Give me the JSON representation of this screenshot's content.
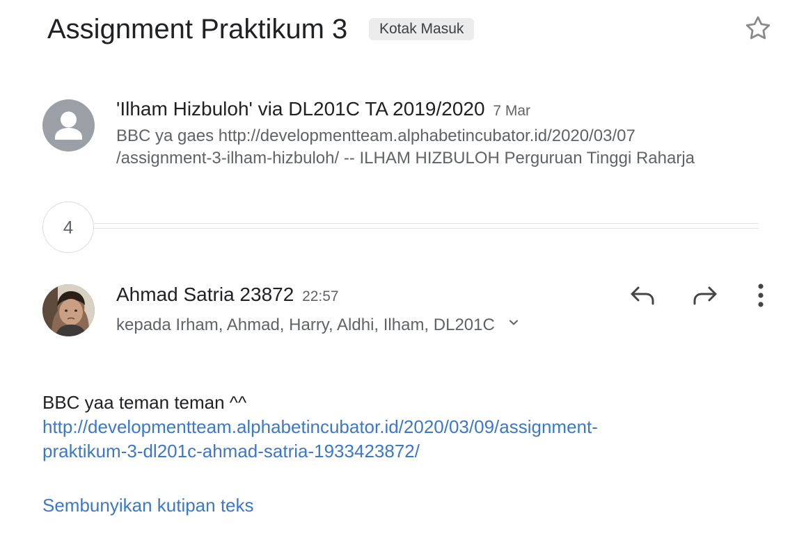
{
  "thread": {
    "subject": "Assignment Praktikum 3",
    "label": "Kotak Masuk",
    "star_icon": "star-outline-icon"
  },
  "messages": [
    {
      "sender": "'Ilham Hizbuloh' via DL201C TA 2019/2020",
      "date": "7 Mar",
      "snippet_line1": "BBC ya gaes http://developmentteam.alphabetincubator.id/2020/03/07",
      "snippet_line2": "/assignment-3-ilham-hizbuloh/ -- ILHAM HIZBULOH Perguruan Tinggi Raharja",
      "avatar_icon": "person-placeholder-icon"
    }
  ],
  "collapsed": {
    "count": "4"
  },
  "open_message": {
    "sender": "Ahmad Satria 23872",
    "time": "22:57",
    "recipients": "kepada Irham, Ahmad, Harry, Aldhi, Ilham, DL201C",
    "body_text": "BBC yaa teman teman ^^",
    "link_line1": "http://developmentteam.alphabetincubator.id/2020/03/09/assignment-",
    "link_line2": "praktikum-3-dl201c-ahmad-satria-1933423872/",
    "hide_quoted": "Sembunyikan kutipan teks",
    "icons": {
      "reply": "reply-icon",
      "forward": "forward-icon",
      "more": "more-vert-icon",
      "expand": "chevron-down-icon"
    }
  },
  "colors": {
    "link": "#3b78c9",
    "chip_bg": "#ececec",
    "secondary_text": "#5f6368",
    "avatar_gray": "#9aa0a6"
  }
}
